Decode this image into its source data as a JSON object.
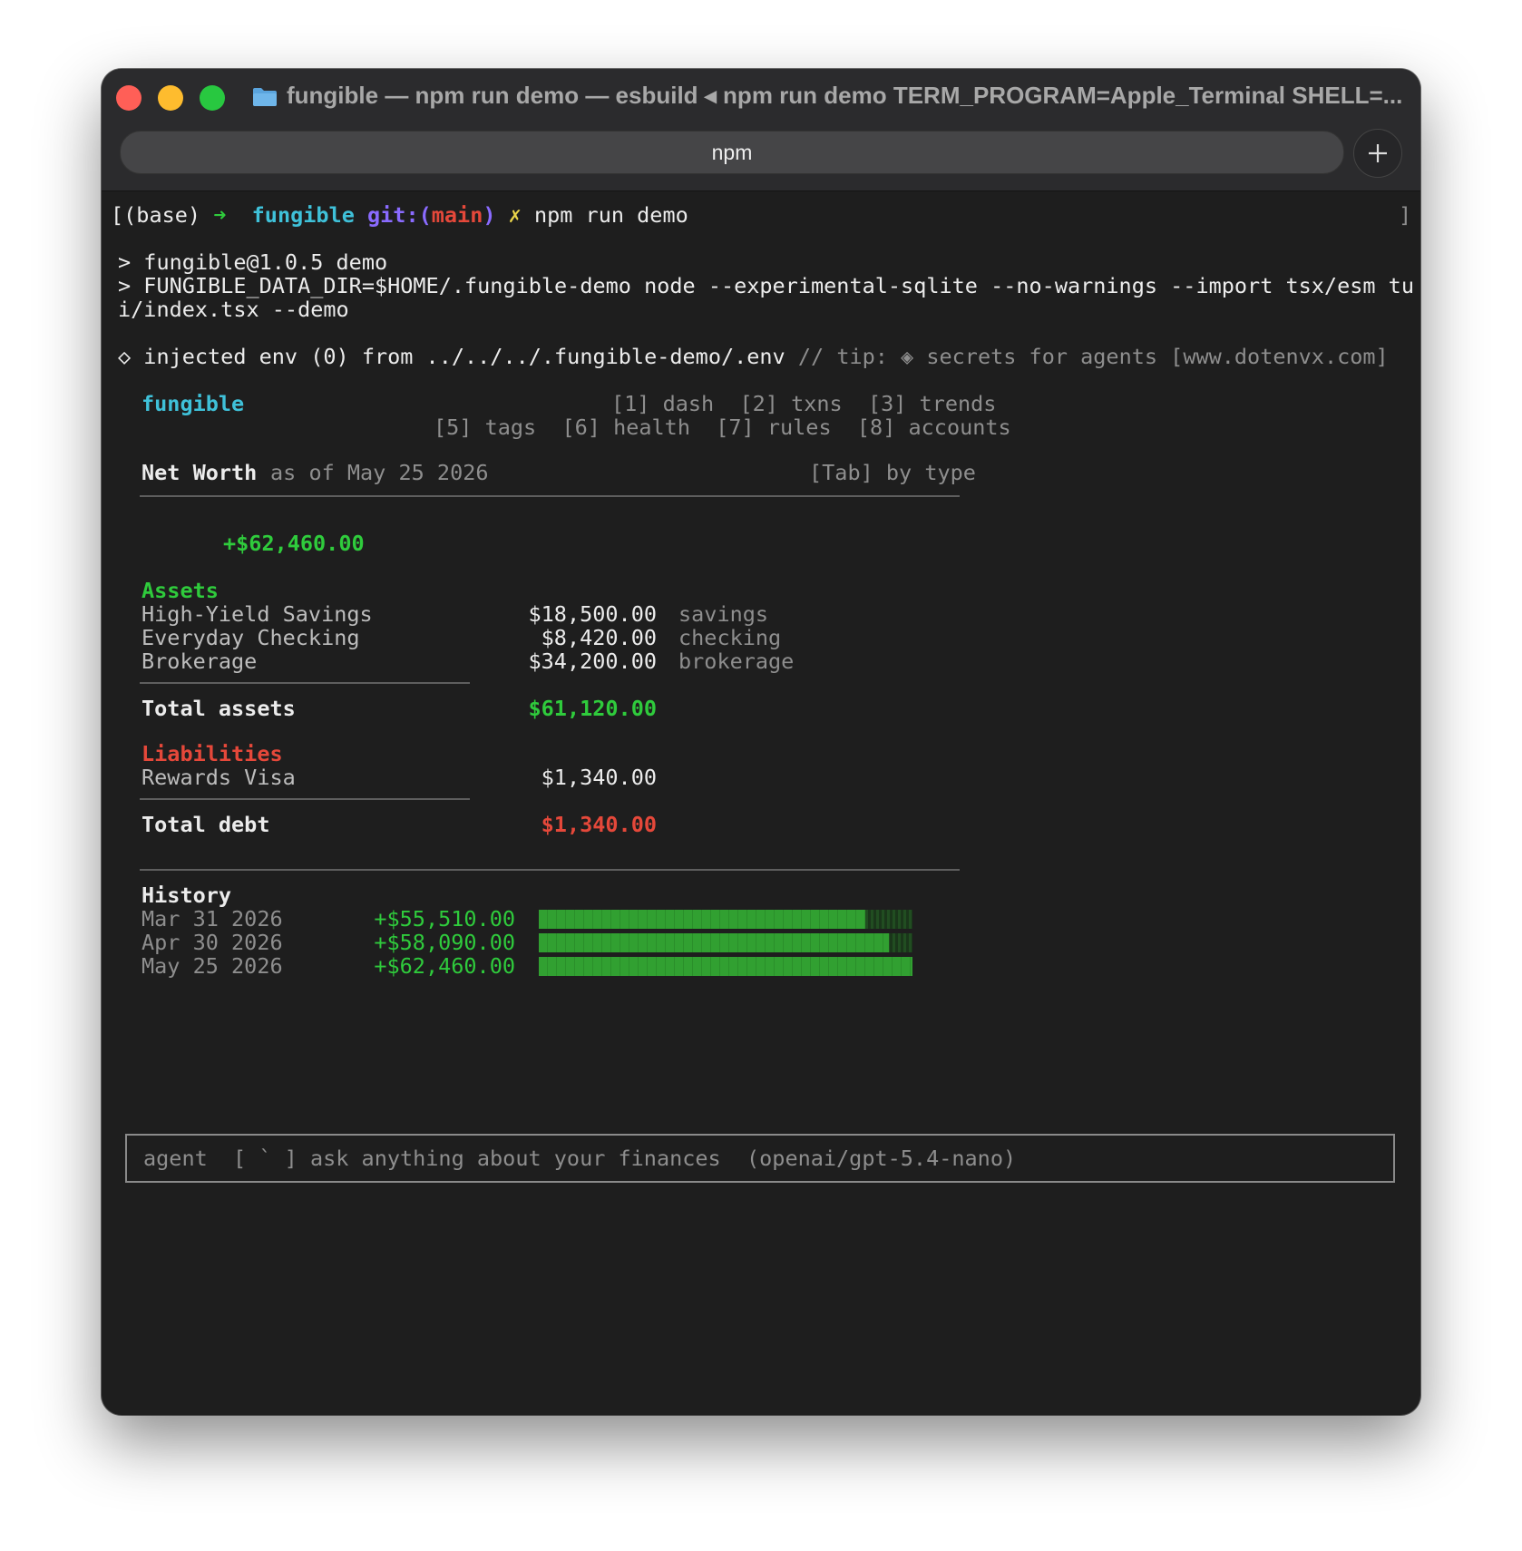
{
  "window": {
    "title": "fungible — npm run demo — esbuild ◂ npm run demo TERM_PROGRAM=Apple_Terminal SHELL=...",
    "tab_label": "npm",
    "new_tab_symbol": "+"
  },
  "prompt": {
    "base": "[(base)",
    "arrow": "➜",
    "dir": "fungible",
    "git_label": "git:(",
    "branch": "main",
    "git_close": ")",
    "dirty": "✗",
    "command": "npm run demo",
    "right_bracket": "]"
  },
  "npm_output": {
    "line1": "> fungible@1.0.5 demo",
    "line2": "> FUNGIBLE_DATA_DIR=$HOME/.fungible-demo node --experimental-sqlite --no-warnings --import tsx/esm tu",
    "line3": "i/index.tsx --demo"
  },
  "dotenv": {
    "main": "◇ injected env (0) from ../../../.fungible-demo/.env",
    "tip": "// tip: ◈ secrets for agents [www.dotenvx.com]"
  },
  "app": {
    "name": "fungible",
    "nav_row1": [
      "[1] dash",
      "[2] txns",
      "[3] trends"
    ],
    "nav_row2": [
      "[5] tags",
      "[6] health",
      "[7] rules",
      "[8] accounts"
    ]
  },
  "net_worth": {
    "title": "Net Worth",
    "as_of": "as of May 25 2026",
    "tab_hint": "[Tab] by type",
    "total": "+$62,460.00"
  },
  "assets": {
    "heading": "Assets",
    "items": [
      {
        "name": "High-Yield Savings",
        "amount": "$18,500.00",
        "type": "savings"
      },
      {
        "name": "Everyday Checking",
        "amount": "$8,420.00",
        "type": "checking"
      },
      {
        "name": "Brokerage",
        "amount": "$34,200.00",
        "type": "brokerage"
      }
    ],
    "total_label": "Total assets",
    "total_value": "$61,120.00"
  },
  "liabilities": {
    "heading": "Liabilities",
    "items": [
      {
        "name": "Rewards Visa",
        "amount": "$1,340.00"
      }
    ],
    "total_label": "Total debt",
    "total_value": "$1,340.00"
  },
  "history": {
    "heading": "History",
    "rows": [
      {
        "date": "Mar 31 2026",
        "value": "+$55,510.00",
        "fill": 0.874
      },
      {
        "date": "Apr 30 2026",
        "value": "+$58,090.00",
        "fill": 0.937
      },
      {
        "date": "May 25 2026",
        "value": "+$62,460.00",
        "fill": 1.0
      }
    ]
  },
  "agent_bar": {
    "label": "agent",
    "shortcut": "[ ` ]",
    "hint": "ask anything about your finances",
    "model": "(openai/gpt-5.4-nano)"
  },
  "colors": {
    "accent_cyan": "#3fc1d9",
    "positive_green": "#2fcb3c",
    "negative_red": "#e5483a",
    "git_purple": "#8a6bff"
  }
}
